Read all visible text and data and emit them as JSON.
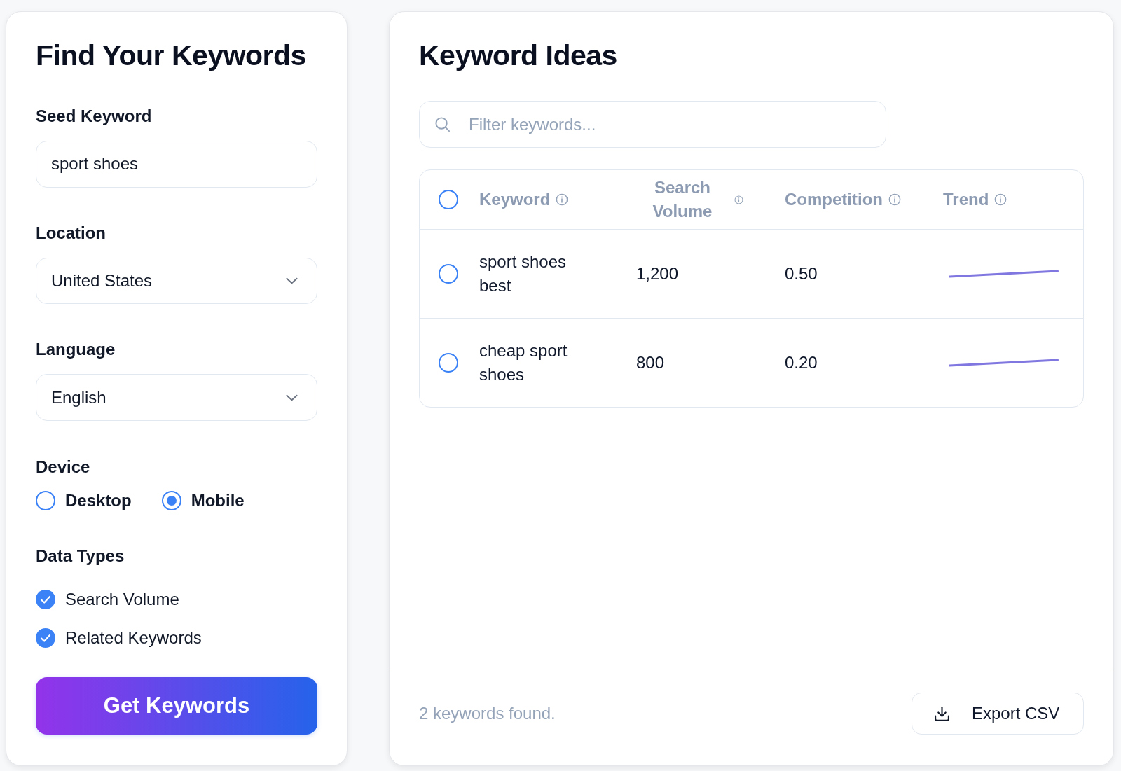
{
  "keyword_form": {
    "title": "Find Your Keywords",
    "seed_keyword": {
      "label": "Seed Keyword",
      "value": "sport shoes"
    },
    "location": {
      "label": "Location",
      "value": "United States"
    },
    "language": {
      "label": "Language",
      "value": "English"
    },
    "device": {
      "label": "Device",
      "options": [
        {
          "label": "Desktop",
          "selected": false
        },
        {
          "label": "Mobile",
          "selected": true
        }
      ]
    },
    "data_types": {
      "label": "Data Types",
      "options": [
        {
          "label": "Search Volume",
          "checked": true
        },
        {
          "label": "Related Keywords",
          "checked": true
        }
      ]
    },
    "submit_button": "Get Keywords"
  },
  "keyword_ideas": {
    "title": "Keyword Ideas",
    "filter": {
      "placeholder": "Filter keywords..."
    },
    "table": {
      "select_all": {
        "checked": false
      },
      "columns": [
        "Keyword",
        "Search Volume",
        "Competition",
        "Trend"
      ],
      "rows": [
        {
          "selected": false,
          "keyword": "sport shoes best",
          "search_volume": "1,200",
          "competition": "0.50"
        },
        {
          "selected": false,
          "keyword": "cheap sport shoes",
          "search_volume": "800",
          "competition": "0.20"
        }
      ]
    },
    "status": "2 keywords found.",
    "export_button": "Export CSV"
  }
}
